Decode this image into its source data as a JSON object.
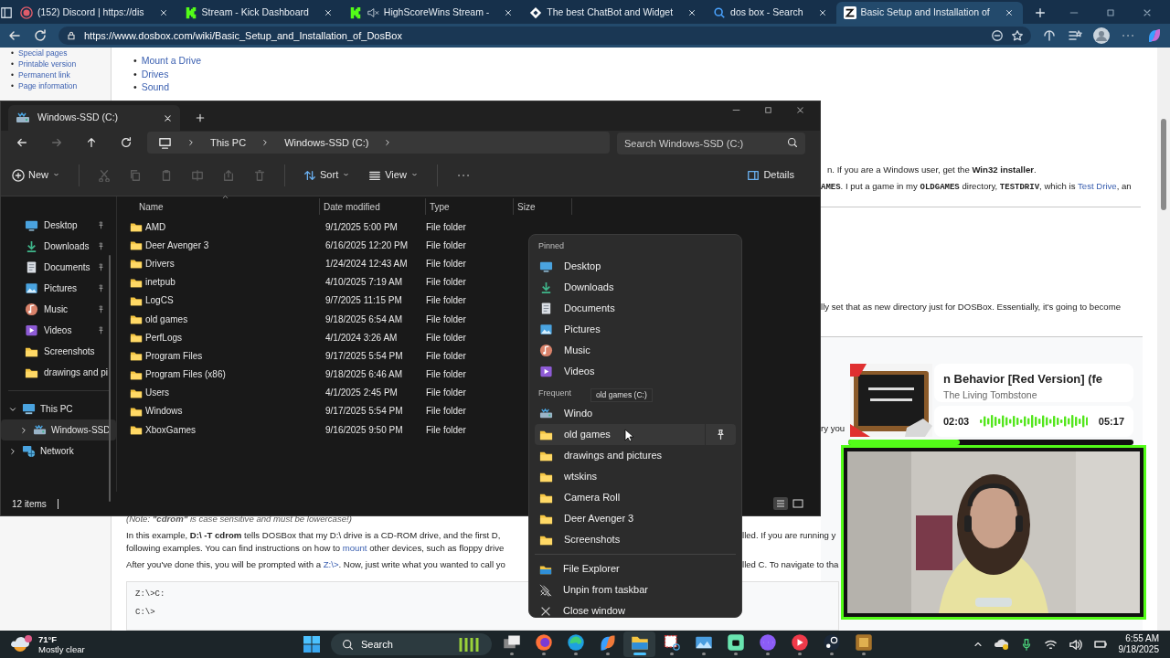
{
  "browser": {
    "tabs": [
      {
        "title": "(152) Discord | https://dis",
        "kind": "record",
        "selected": false,
        "muted": false
      },
      {
        "title": "Stream - Kick Dashboard",
        "kind": "kick",
        "selected": false,
        "muted": false
      },
      {
        "title": "HighScoreWins Stream - ",
        "kind": "kick",
        "selected": false,
        "muted": true
      },
      {
        "title": "The best ChatBot and Widget",
        "kind": "diamond",
        "selected": false,
        "muted": false
      },
      {
        "title": "dos box - Search",
        "kind": "search",
        "selected": false,
        "muted": false
      },
      {
        "title": "Basic Setup and Installation of",
        "kind": "site",
        "selected": true,
        "muted": false
      }
    ],
    "address": "https://www.dosbox.com/wiki/Basic_Setup_and_Installation_of_DosBox",
    "page": {
      "sidebar_links": [
        {
          "marker": "•",
          "text": "Special pages"
        },
        {
          "marker": "•",
          "text": "Printable version"
        },
        {
          "marker": "•",
          "text": "Permanent link"
        },
        {
          "marker": "•",
          "text": "Page information"
        }
      ],
      "toc_links": [
        {
          "marker": "•",
          "text": "Mount a Drive"
        },
        {
          "marker": "•",
          "text": "Drives"
        },
        {
          "marker": "•",
          "text": "Sound"
        }
      ],
      "fragments": [
        {
          "runs": [
            {
              "kind": "plain",
              "text": "n. If you are a Windows user, get the "
            },
            {
              "kind": "bold",
              "text": "Win32 installer"
            },
            {
              "kind": "plain",
              "text": "."
            }
          ]
        },
        {
          "runs": [
            {
              "kind": "code",
              "text": "AMES"
            },
            {
              "kind": "plain",
              "text": ". I put a game in my "
            },
            {
              "kind": "code",
              "text": "OLDGAMES"
            },
            {
              "kind": "plain",
              "text": " directory, "
            },
            {
              "kind": "code",
              "text": "TESTDRIV"
            },
            {
              "kind": "plain",
              "text": ", which is "
            },
            {
              "kind": "link",
              "text": "Test Drive"
            },
            {
              "kind": "plain",
              "text": ", an"
            }
          ]
        },
        {
          "runs": [
            {
              "kind": "plain",
              "text": "lly set that as new directory just for DOSBox. Essentially, it's going to become"
            }
          ]
        },
        {
          "runs": [
            {
              "kind": "plain",
              "text": "ry you"
            }
          ]
        },
        {
          "runs": [
            {
              "kind": "italic",
              "text": "(Note: "
            },
            {
              "kind": "bolditalic",
              "text": "\"cdrom\""
            },
            {
              "kind": "italic",
              "text": " is case sensitive and must be lowercase!)"
            }
          ]
        },
        {
          "runs": [
            {
              "kind": "plain",
              "text": "In this example, "
            },
            {
              "kind": "bold",
              "text": "D:\\ -T cdrom"
            },
            {
              "kind": "plain",
              "text": " tells DOSBox that my D:\\ drive is a CD-ROM drive, and the first D,"
            }
          ]
        },
        {
          "runs": [
            {
              "kind": "plain",
              "text": "lled. If you are running y"
            }
          ]
        },
        {
          "runs": [
            {
              "kind": "plain",
              "text": "following examples. You can find instructions on how to "
            },
            {
              "kind": "link",
              "text": "mount"
            },
            {
              "kind": "plain",
              "text": " other devices, such as floppy drive"
            }
          ]
        },
        {
          "runs": [
            {
              "kind": "plain",
              "text": "After you've done this, you will be prompted with a "
            },
            {
              "kind": "link",
              "text": "Z:\\>"
            },
            {
              "kind": "plain",
              "text": ". Now, just write what you wanted to call yo"
            }
          ]
        },
        {
          "runs": [
            {
              "kind": "plain",
              "text": "lled C. To navigate to tha"
            }
          ]
        }
      ],
      "code_lines": [
        "Z:\\>C:",
        "C:\\>"
      ]
    }
  },
  "explorer": {
    "tab": "Windows-SSD (C:)",
    "breadcrumb": [
      "This PC",
      "Windows-SSD (C:)"
    ],
    "search": {
      "placeholder": "Search Windows-SSD (C:)"
    },
    "toolbar": {
      "new": "New",
      "sort": "Sort",
      "view": "View",
      "details": "Details"
    },
    "quick_access": [
      {
        "label": "Desktop",
        "kind": "desktop",
        "pinned": true
      },
      {
        "label": "Downloads",
        "kind": "download",
        "pinned": true
      },
      {
        "label": "Documents",
        "kind": "document",
        "pinned": true
      },
      {
        "label": "Pictures",
        "kind": "picture",
        "pinned": true
      },
      {
        "label": "Music",
        "kind": "music",
        "pinned": true
      },
      {
        "label": "Videos",
        "kind": "video",
        "pinned": true
      },
      {
        "label": "Screenshots",
        "kind": "folder",
        "pinned": false
      },
      {
        "label": "drawings and pi",
        "kind": "folder",
        "pinned": false
      }
    ],
    "tree": [
      {
        "label": "This PC",
        "kind": "pc",
        "expanded": true,
        "selected": false,
        "children": [
          {
            "label": "Windows-SSD",
            "kind": "drive",
            "expanded": false,
            "selected": true
          }
        ]
      },
      {
        "label": "Network",
        "kind": "network",
        "expanded": false,
        "selected": false
      }
    ],
    "columns": [
      "Name",
      "Date modified",
      "Type",
      "Size"
    ],
    "rows": [
      {
        "name": "AMD",
        "date": "9/1/2025 5:00 PM",
        "type": "File folder"
      },
      {
        "name": "Deer Avenger 3",
        "date": "6/16/2025 12:20 PM",
        "type": "File folder"
      },
      {
        "name": "Drivers",
        "date": "1/24/2024 12:43 AM",
        "type": "File folder"
      },
      {
        "name": "inetpub",
        "date": "4/10/2025 7:19 AM",
        "type": "File folder"
      },
      {
        "name": "LogCS",
        "date": "9/7/2025 11:15 PM",
        "type": "File folder"
      },
      {
        "name": "old games",
        "date": "9/18/2025 6:54 AM",
        "type": "File folder"
      },
      {
        "name": "PerfLogs",
        "date": "4/1/2024 3:26 AM",
        "type": "File folder"
      },
      {
        "name": "Program Files",
        "date": "9/17/2025 5:54 PM",
        "type": "File folder"
      },
      {
        "name": "Program Files (x86)",
        "date": "9/18/2025 6:46 AM",
        "type": "File folder"
      },
      {
        "name": "Users",
        "date": "4/1/2025 2:45 PM",
        "type": "File folder"
      },
      {
        "name": "Windows",
        "date": "9/17/2025 5:54 PM",
        "type": "File folder"
      },
      {
        "name": "XboxGames",
        "date": "9/16/2025 9:50 PM",
        "type": "File folder"
      }
    ],
    "status": "12 items"
  },
  "jump_list": {
    "sections": [
      {
        "title": "Pinned",
        "items": [
          {
            "label": "Desktop",
            "kind": "desktop",
            "hovered": false
          },
          {
            "label": "Downloads",
            "kind": "download",
            "hovered": false
          },
          {
            "label": "Documents",
            "kind": "document",
            "hovered": false
          },
          {
            "label": "Pictures",
            "kind": "picture",
            "hovered": false
          },
          {
            "label": "Music",
            "kind": "music",
            "hovered": false
          },
          {
            "label": "Videos",
            "kind": "video",
            "hovered": false
          }
        ]
      },
      {
        "title": "Frequent",
        "items": [
          {
            "label": "Windo",
            "kind": "drive",
            "hovered": false
          },
          {
            "label": "old games",
            "kind": "folder",
            "hovered": true
          },
          {
            "label": "drawings and pictures",
            "kind": "folder",
            "hovered": false
          },
          {
            "label": "wtskins",
            "kind": "folder",
            "hovered": false
          },
          {
            "label": "Camera Roll",
            "kind": "folder",
            "hovered": false
          },
          {
            "label": "Deer Avenger 3",
            "kind": "folder",
            "hovered": false
          },
          {
            "label": "Screenshots",
            "kind": "folder",
            "hovered": false
          }
        ]
      }
    ],
    "actions": [
      {
        "label": "File Explorer",
        "kind": "explorer"
      },
      {
        "label": "Unpin from taskbar",
        "kind": "unpin"
      },
      {
        "label": "Close window",
        "kind": "close"
      }
    ],
    "tooltip": "old games (C:)"
  },
  "now_playing": {
    "title": "n Behavior [Red Version] (fe",
    "artist": "The Living Tombstone",
    "elapsed": "02:03",
    "duration": "05:17",
    "level": 0.39
  },
  "taskbar": {
    "weather": {
      "temp": "71°F",
      "condition": "Mostly clear"
    },
    "search": "Search",
    "apps": [
      {
        "kind": "taskview",
        "active": false
      },
      {
        "kind": "firefox",
        "active": false
      },
      {
        "kind": "edge",
        "active": false
      },
      {
        "kind": "copilot",
        "active": false
      },
      {
        "kind": "explorer",
        "active": true
      },
      {
        "kind": "snip",
        "active": false
      },
      {
        "kind": "photos",
        "active": false
      },
      {
        "kind": "chat",
        "active": false
      },
      {
        "kind": "messenger",
        "active": false
      },
      {
        "kind": "play",
        "active": false
      },
      {
        "kind": "steam",
        "active": false
      },
      {
        "kind": "game",
        "active": false
      }
    ],
    "time": "6:55 AM",
    "date": "9/18/2025"
  }
}
